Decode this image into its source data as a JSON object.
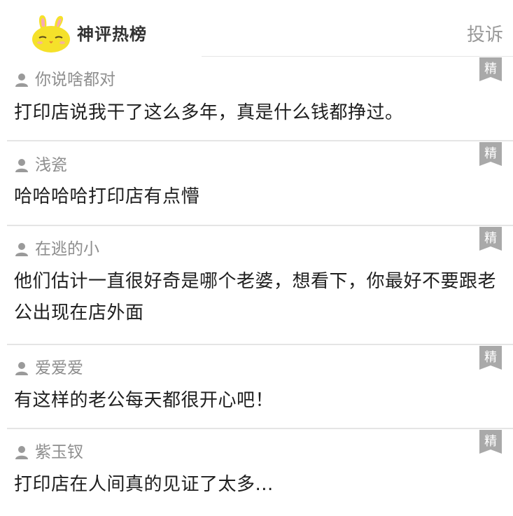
{
  "header": {
    "title": "神评热榜",
    "report_label": "投诉"
  },
  "badge_label": "精",
  "comments": [
    {
      "user": "你说啥都对",
      "text": "打印店说我干了这么多年，真是什么钱都挣过。"
    },
    {
      "user": "浅瓷",
      "text": "哈哈哈哈打印店有点懵"
    },
    {
      "user": "在逃的小",
      "text": "他们估计一直很好奇是哪个老婆，想看下，你最好不要跟老公出现在店外面"
    },
    {
      "user": "爱爱爱",
      "text": "有这样的老公每天都很开心吧！"
    },
    {
      "user": "紫玉钗",
      "text": "打印店在人间真的见证了太多..."
    }
  ],
  "colors": {
    "mascot_yellow": "#f5e12a",
    "badge_gray": "#a9a9a9",
    "divider": "#e5e5e5",
    "username": "#8e8e8e"
  }
}
